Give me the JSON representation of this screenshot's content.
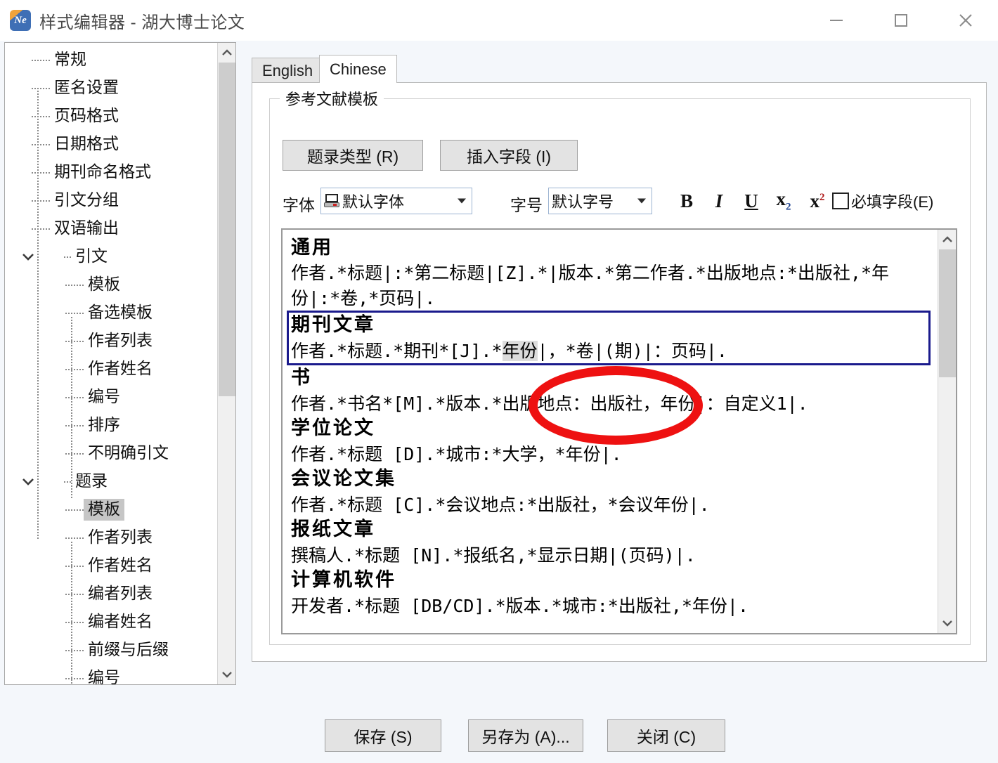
{
  "window": {
    "title": "样式编辑器 - 湖大博士论文",
    "icon": "Ne",
    "controls": {
      "minimize": "minimize-icon",
      "maximize": "maximize-icon",
      "close": "close-icon"
    }
  },
  "sidebar": {
    "items": [
      {
        "label": "常规",
        "level": 1,
        "selected": false,
        "expander": null
      },
      {
        "label": "匿名设置",
        "level": 1,
        "selected": false,
        "expander": null
      },
      {
        "label": "页码格式",
        "level": 1,
        "selected": false,
        "expander": null
      },
      {
        "label": "日期格式",
        "level": 1,
        "selected": false,
        "expander": null
      },
      {
        "label": "期刊命名格式",
        "level": 1,
        "selected": false,
        "expander": null
      },
      {
        "label": "引文分组",
        "level": 1,
        "selected": false,
        "expander": null
      },
      {
        "label": "双语输出",
        "level": 1,
        "selected": false,
        "expander": null
      },
      {
        "label": "引文",
        "level": 1,
        "selected": false,
        "expander": "expanded"
      },
      {
        "label": "模板",
        "level": 2,
        "selected": false,
        "expander": null
      },
      {
        "label": "备选模板",
        "level": 2,
        "selected": false,
        "expander": null
      },
      {
        "label": "作者列表",
        "level": 2,
        "selected": false,
        "expander": null
      },
      {
        "label": "作者姓名",
        "level": 2,
        "selected": false,
        "expander": null
      },
      {
        "label": "编号",
        "level": 2,
        "selected": false,
        "expander": null
      },
      {
        "label": "排序",
        "level": 2,
        "selected": false,
        "expander": null
      },
      {
        "label": "不明确引文",
        "level": 2,
        "selected": false,
        "expander": null
      },
      {
        "label": "题录",
        "level": 1,
        "selected": false,
        "expander": "expanded"
      },
      {
        "label": "模板",
        "level": 2,
        "selected": true,
        "expander": null
      },
      {
        "label": "作者列表",
        "level": 2,
        "selected": false,
        "expander": null
      },
      {
        "label": "作者姓名",
        "level": 2,
        "selected": false,
        "expander": null
      },
      {
        "label": "编者列表",
        "level": 2,
        "selected": false,
        "expander": null
      },
      {
        "label": "编者姓名",
        "level": 2,
        "selected": false,
        "expander": null
      },
      {
        "label": "前缀与后缀",
        "level": 2,
        "selected": false,
        "expander": null
      },
      {
        "label": "编号",
        "level": 2,
        "selected": false,
        "expander": null
      }
    ],
    "scrollbar": {
      "up_icon": "chevron-up-icon",
      "down_icon": "chevron-down-icon"
    }
  },
  "tabs": [
    {
      "label": "English",
      "active": false
    },
    {
      "label": "Chinese",
      "active": true
    }
  ],
  "panel": {
    "group_legend": "参考文献模板",
    "buttons": {
      "record_type": "题录类型 (R)",
      "insert_field": "插入字段 (I)"
    },
    "font_row": {
      "font_label": "字体",
      "font_value": "默认字体",
      "font_icon": "font-preview-icon",
      "size_label": "字号",
      "size_value": "默认字号",
      "bold": "B",
      "italic": "I",
      "underline": "U",
      "subscript_base": "x",
      "subscript_mark": "2",
      "superscript_base": "x",
      "superscript_mark": "2",
      "required_checkbox_label": "必填字段(E)",
      "required_checked": false
    },
    "editor": {
      "sections": [
        {
          "heading": "通用",
          "selected": false,
          "body_parts": [
            {
              "text": "作者.*标题|:*第二标题|[Z].*|版本.*第二作者.*出版地点:*出版社,*年份|:*卷,*页码|.",
              "highlight": false
            }
          ]
        },
        {
          "heading": "期刊文章",
          "selected": true,
          "body_parts": [
            {
              "text": "作者.*标题.*期刊*[J].*",
              "highlight": false
            },
            {
              "text": "年份",
              "highlight": true
            },
            {
              "text": "|，*卷|(期)|：页码|.",
              "highlight": false
            }
          ]
        },
        {
          "heading": "书",
          "selected": false,
          "body_parts": [
            {
              "text": "作者.*书名*[M].*版本.*出版地点：出版社，年份|：自定义1|.",
              "highlight": false
            }
          ]
        },
        {
          "heading": "学位论文",
          "selected": false,
          "body_parts": [
            {
              "text": "作者.*标题 [D].*城市:*大学，*年份|.",
              "highlight": false
            }
          ]
        },
        {
          "heading": "会议论文集",
          "selected": false,
          "body_parts": [
            {
              "text": "作者.*标题 [C].*会议地点:*出版社，*会议年份|.",
              "highlight": false
            }
          ]
        },
        {
          "heading": "报纸文章",
          "selected": false,
          "body_parts": [
            {
              "text": "撰稿人.*标题 [N].*报纸名,*显示日期|(页码)|.",
              "highlight": false
            }
          ]
        },
        {
          "heading": "计算机软件",
          "selected": false,
          "body_parts": [
            {
              "text": "开发者.*标题 [DB/CD].*版本.*城市:*出版社,*年份|.",
              "highlight": false
            }
          ]
        }
      ],
      "scrollbar": {
        "up_icon": "chevron-up-icon",
        "down_icon": "chevron-down-icon"
      }
    }
  },
  "footer": {
    "save": "保存 (S)",
    "save_as": "另存为 (A)...",
    "close": "关闭 (C)"
  },
  "annotation": {
    "shape": "ellipse",
    "color": "#ee1111"
  },
  "colors": {
    "selection_highlight": "#c6c6c6",
    "selected_section_border": "#1a1a8c",
    "window_background": "#f4f7fb",
    "button_face": "#e3e3e3"
  }
}
